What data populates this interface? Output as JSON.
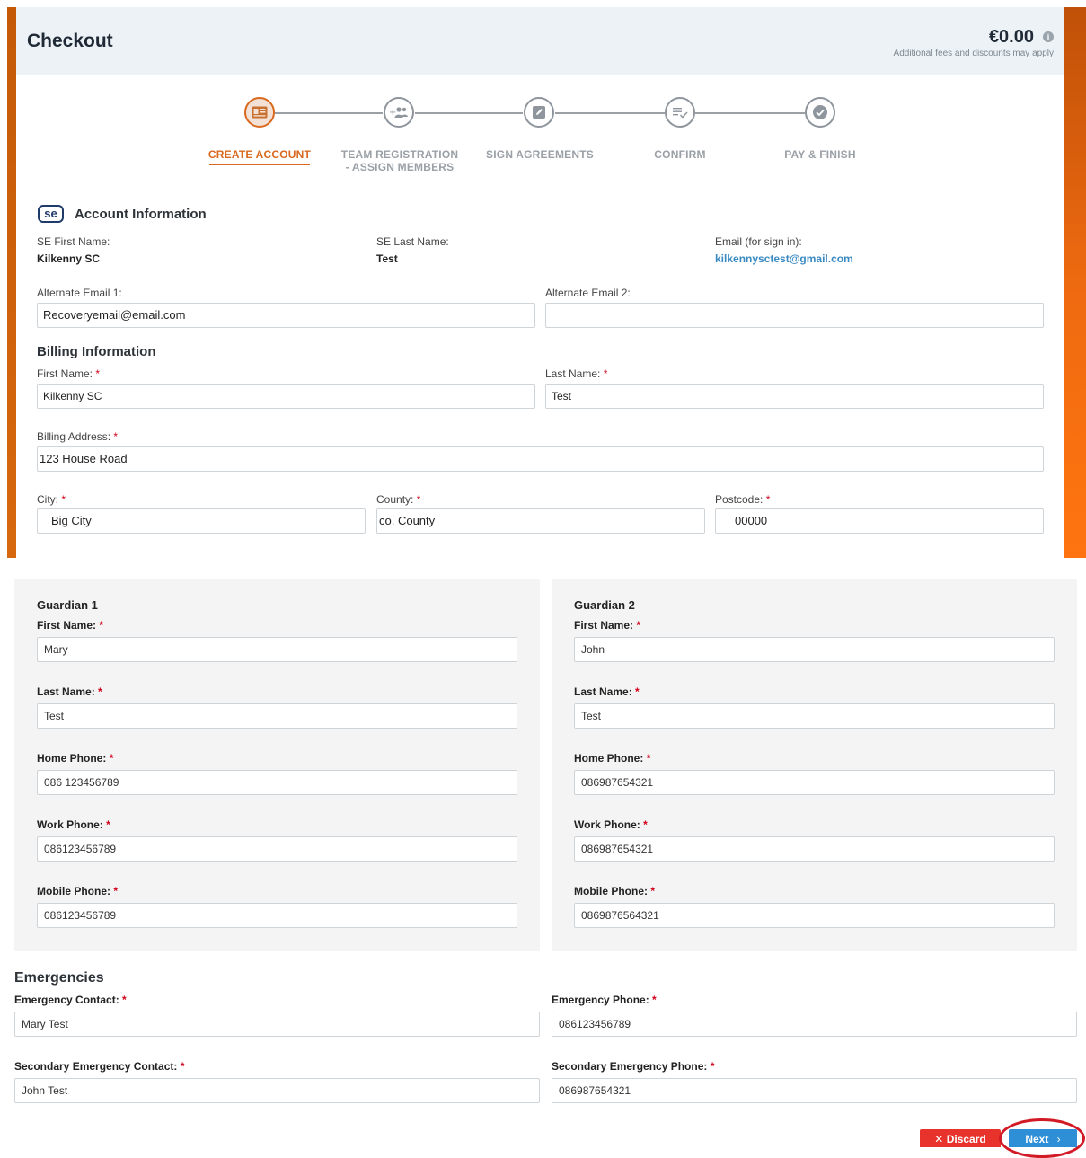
{
  "header": {
    "title": "Checkout",
    "price": "€0.00",
    "price_note": "Additional fees and discounts may apply"
  },
  "steps": [
    {
      "label": "CREATE ACCOUNT",
      "icon": "id-card-icon",
      "active": true
    },
    {
      "label": "TEAM REGISTRATION - ASSIGN MEMBERS",
      "icon": "add-group-icon",
      "active": false
    },
    {
      "label": "SIGN AGREEMENTS",
      "icon": "edit-icon",
      "active": false
    },
    {
      "label": "CONFIRM",
      "icon": "checklist-icon",
      "active": false
    },
    {
      "label": "PAY & FINISH",
      "icon": "check-circle-icon",
      "active": false
    }
  ],
  "step_label_lines": {
    "team_line1": "TEAM REGISTRATION",
    "team_line2": "- ASSIGN MEMBERS"
  },
  "account": {
    "logo_text": "se",
    "title": "Account Information",
    "first_name_label": "SE First Name:",
    "first_name": "Kilkenny SC",
    "last_name_label": "SE Last Name:",
    "last_name": "Test",
    "email_label": "Email (for sign in):",
    "email": "kilkennysctest@gmail.com",
    "alt_email1_label": "Alternate Email 1:",
    "alt_email1": "Recoveryemail@email.com",
    "alt_email2_label": "Alternate Email 2:",
    "alt_email2": ""
  },
  "billing": {
    "title": "Billing Information",
    "first_name_label": "First Name:",
    "first_name": "Kilkenny SC",
    "last_name_label": "Last Name:",
    "last_name": "Test",
    "address_label": "Billing Address:",
    "address": "123 House Road",
    "city_label": "City:",
    "city": "Big City",
    "county_label": "County:",
    "county": "co. County",
    "postcode_label": "Postcode:",
    "postcode": "00000"
  },
  "required_mark": "*",
  "guardians": [
    {
      "title": "Guardian 1",
      "first_name_label": "First Name:",
      "first_name": "Mary",
      "last_name_label": "Last Name:",
      "last_name": "Test",
      "home_phone_label": "Home Phone:",
      "home_phone": "086 123456789",
      "work_phone_label": "Work Phone:",
      "work_phone": "086123456789",
      "mobile_phone_label": "Mobile Phone:",
      "mobile_phone": "086123456789"
    },
    {
      "title": "Guardian 2",
      "first_name_label": "First Name:",
      "first_name": "John",
      "last_name_label": "Last Name:",
      "last_name": "Test",
      "home_phone_label": "Home Phone:",
      "home_phone": "086987654321",
      "work_phone_label": "Work Phone:",
      "work_phone": "086987654321",
      "mobile_phone_label": "Mobile Phone:",
      "mobile_phone": "0869876564321"
    }
  ],
  "emergencies": {
    "title": "Emergencies",
    "contact_label": "Emergency Contact:",
    "contact": "Mary Test",
    "phone_label": "Emergency Phone:",
    "phone": "086123456789",
    "secondary_contact_label": "Secondary Emergency Contact:",
    "secondary_contact": "John Test",
    "secondary_phone_label": "Secondary Emergency Phone:",
    "secondary_phone": "086987654321"
  },
  "actions": {
    "discard_label": "Discard",
    "discard_icon": "close-icon",
    "next_label": "Next",
    "next_icon": "chevron-right-icon"
  },
  "colors": {
    "accent": "#d8691f",
    "link": "#3a8ac2",
    "discard": "#e8332c",
    "next": "#2f8fd6",
    "annotation_circle": "#d21a26"
  }
}
